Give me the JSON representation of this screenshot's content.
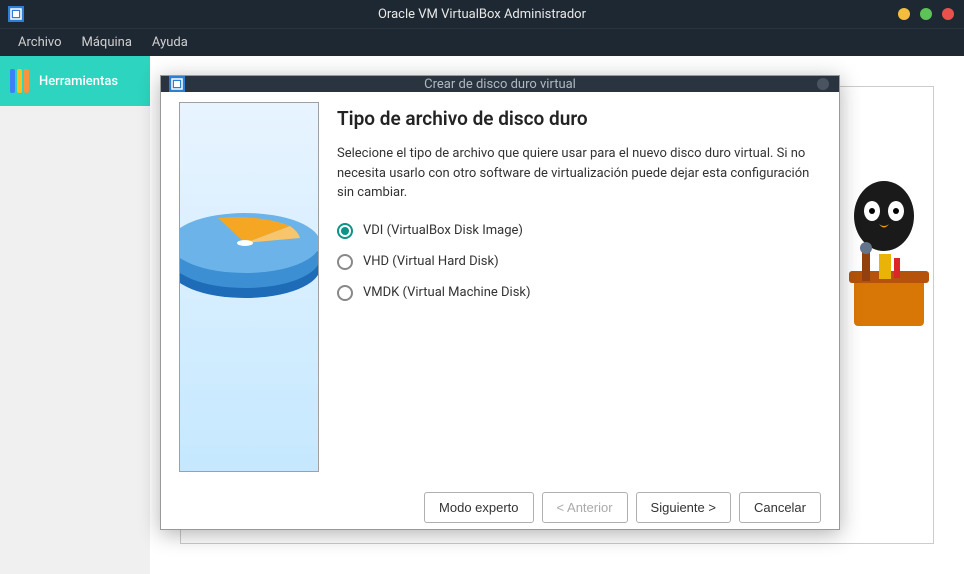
{
  "window": {
    "title": "Oracle VM VirtualBox Administrador"
  },
  "menu": {
    "file": "Archivo",
    "machine": "Máquina",
    "help": "Ayuda"
  },
  "sidebar": {
    "tools": "Herramientas"
  },
  "modal": {
    "title": "Crear de disco duro virtual",
    "heading": "Tipo de archivo de disco duro",
    "description": "Selecione el tipo de archivo que quiere usar para el nuevo disco duro virtual. Si no necesita usarlo con otro software de virtualización puede dejar esta configuración sin cambiar.",
    "options": [
      {
        "label": "VDI (VirtualBox Disk Image)",
        "selected": true
      },
      {
        "label": "VHD (Virtual Hard Disk)",
        "selected": false
      },
      {
        "label": "VMDK (Virtual Machine Disk)",
        "selected": false
      }
    ],
    "buttons": {
      "expert": "Modo experto",
      "back": "< Anterior",
      "next": "Siguiente >",
      "cancel": "Cancelar"
    }
  }
}
